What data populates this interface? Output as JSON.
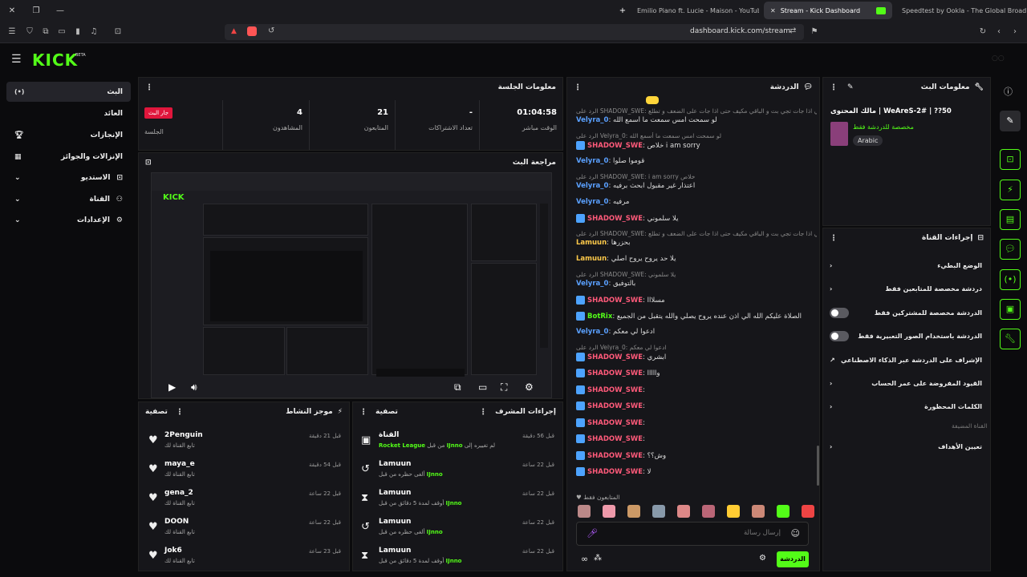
{
  "browser": {
    "tabs": [
      {
        "title": "Emilio Piano ft. Lucie - Maison - YouTube"
      },
      {
        "title": "Stream - Kick Dashboard"
      },
      {
        "title": "Speedtest by Ookla - The Global Broadband"
      }
    ],
    "url": "dashboard.kick.com/stream"
  },
  "brand": {
    "logo": "KICK",
    "beta": "BETA",
    "accent": "#53fc18"
  },
  "sidebar": {
    "items": [
      {
        "label": "البث",
        "icon": "broadcast-icon"
      },
      {
        "label": "العائد",
        "icon": ""
      },
      {
        "label": "الإنجازات",
        "icon": "trophy-icon"
      },
      {
        "label": "الإنزالات والجوائز",
        "icon": "gift-icon"
      },
      {
        "label": "الاستديو",
        "icon": "studio-icon"
      },
      {
        "label": "القناة",
        "icon": "users-icon"
      },
      {
        "label": "الإعدادات",
        "icon": "gear-icon"
      }
    ]
  },
  "session": {
    "title": "معلومات الجلسة",
    "live_badge": "جار البث",
    "session_label": "الجلسة",
    "stats": [
      {
        "value": "01:04:58",
        "label": "الوقت مباشر"
      },
      {
        "value": "-",
        "label": "تعداد الاشتراكات"
      },
      {
        "value": "21",
        "label": "المتابعون"
      },
      {
        "value": "4",
        "label": "المشاهدون"
      }
    ]
  },
  "preview": {
    "title": "مراجعة البث"
  },
  "activity": {
    "title": "موجز النشاط",
    "filter": "تصفية",
    "items": [
      {
        "name": "2Penguin",
        "sub": "تابع القناة لك",
        "time": "قبل 21 دقيقة"
      },
      {
        "name": "maya_e",
        "sub": "تابع القناة لك",
        "time": "قبل 54 دقيقة"
      },
      {
        "name": "gena_2",
        "sub": "تابع القناة لك",
        "time": "قبل 22 ساعة"
      },
      {
        "name": "DOON",
        "sub": "تابع القناة لك",
        "time": "قبل 22 ساعة"
      },
      {
        "name": "Jok6",
        "sub": "تابع القناة لك",
        "time": "قبل 23 ساعة"
      }
    ]
  },
  "modlog": {
    "title": "إجراءات المشرف",
    "filter": "تصفية",
    "items": [
      {
        "name": "القناة",
        "sub_pre": "Rocket League",
        "sub_mid": " من قبل ",
        "sub_user": "IJnno",
        "sub_post": " لم تغييره إلى",
        "time": "قبل 56 دقيقة",
        "icon": "channel-icon"
      },
      {
        "name": "Lamuun",
        "sub_pre": "",
        "sub_mid": "ألغى حظره من قبل ",
        "sub_user": "IJnno",
        "sub_post": "",
        "time": "قبل 22 ساعة",
        "icon": "undo-icon"
      },
      {
        "name": "Lamuun",
        "sub_pre": "",
        "sub_mid": "أوقف لمدة 5 دقائق من قبل ",
        "sub_user": "IJnno",
        "sub_post": "",
        "time": "قبل 22 ساعة",
        "icon": "hourglass-icon"
      },
      {
        "name": "Lamuun",
        "sub_pre": "",
        "sub_mid": "ألغى حظره من قبل ",
        "sub_user": "IJnno",
        "sub_post": "",
        "time": "قبل 22 ساعة",
        "icon": "undo-icon"
      },
      {
        "name": "Lamuun",
        "sub_pre": "",
        "sub_mid": "أوقف لمدة 5 دقائق من قبل ",
        "sub_user": "IJnno",
        "sub_post": "",
        "time": "قبل 22 ساعة",
        "icon": "hourglass-icon"
      }
    ]
  },
  "chat": {
    "title": "الدردشة",
    "followers_only": "المتابعون فقط",
    "input_placeholder": "إرسال رسالة",
    "send_label": "الدردشة",
    "lines": [
      {
        "reply": "الرد على SHADOW_SWE: دوزني اذا جات تجي بت و الباقي مكيف حتى اذا جات على الضعف و تطلع",
        "user": "Velyra_0",
        "cls": "user-b",
        "text": "لو سمحت امس سمعت ما أسمع الله"
      },
      {
        "reply": "الرد على Velyra_0: لو سمحت امس سمعت ما أسمع الله",
        "user": "SHADOW_SWE",
        "cls": "user-r",
        "text": "خلاص i am sorry"
      },
      {
        "reply": "",
        "user": "Velyra_0",
        "cls": "user-b",
        "text": "قوموا صلوا"
      },
      {
        "reply": "الرد على SHADOW_SWE: i am sorry خلاص",
        "user": "Velyra_0",
        "cls": "user-b",
        "text": "اعتذار غير مقبول ابحث برفيه"
      },
      {
        "reply": "",
        "user": "Velyra_0",
        "cls": "user-b",
        "text": "مرفيه"
      },
      {
        "reply": "",
        "user": "SHADOW_SWE",
        "cls": "user-r",
        "text": "يلا سلموني"
      },
      {
        "reply": "الرد على SHADOW_SWE: دوزني اذا جات تجي بت و الباقي مكيف حتى اذا جات على الضعف و تطلع",
        "user": "Lamuun",
        "cls": "user-y",
        "text": "بحزرها"
      },
      {
        "reply": "",
        "user": "Lamuun",
        "cls": "user-y",
        "text": "يلا حد يروح يروح اصلي"
      },
      {
        "reply": "الرد على SHADOW_SWE: يلا سلموني",
        "user": "Velyra_0",
        "cls": "user-b",
        "text": "بالتوفيق"
      },
      {
        "reply": "",
        "user": "SHADOW_SWE",
        "cls": "user-r",
        "text": "مسلااا"
      },
      {
        "reply": "",
        "user": "BotRix",
        "cls": "user-g",
        "text": "الصلاة عليكم الله الي اذن عنده يروح يصلي والله يتقبل من الجميع"
      },
      {
        "reply": "",
        "user": "Velyra_0",
        "cls": "user-b",
        "text": "ادعوا لي معكم"
      },
      {
        "reply": "الرد على Velyra_0: ادعوا لي معكم",
        "user": "SHADOW_SWE",
        "cls": "user-r",
        "text": "ابشري"
      },
      {
        "reply": "",
        "user": "SHADOW_SWE",
        "cls": "user-r",
        "text": "وااااا"
      },
      {
        "reply": "",
        "user": "SHADOW_SWE",
        "cls": "user-r",
        "text": ""
      },
      {
        "reply": "",
        "user": "SHADOW_SWE",
        "cls": "user-r",
        "text": ""
      },
      {
        "reply": "",
        "user": "SHADOW_SWE",
        "cls": "user-r",
        "text": ""
      },
      {
        "reply": "",
        "user": "SHADOW_SWE",
        "cls": "user-r",
        "text": ""
      },
      {
        "reply": "",
        "user": "SHADOW_SWE",
        "cls": "user-r",
        "text": "وش؟؟"
      },
      {
        "reply": "",
        "user": "SHADOW_SWE",
        "cls": "user-r",
        "text": "لا"
      }
    ]
  },
  "stream_info": {
    "title": "معلومات البث",
    "stream_title": "مالك المحتوى | WeAreS-2# | ??50",
    "sub_line": "مخصصة للدردشة فقط",
    "language": "Arabic"
  },
  "channel_actions": {
    "title": "إجراءات القناة",
    "items": [
      {
        "label": "الوضع البطيء",
        "kind": "chevron"
      },
      {
        "label": "دردشة مخصصة للمتابعين فقط",
        "kind": "chevron"
      },
      {
        "label": "الدردشة مخصصة للمشتركين فقط",
        "kind": "toggle"
      },
      {
        "label": "الدردشة باستخدام الصور التعبيرية فقط",
        "kind": "toggle"
      },
      {
        "label": "الإشراف على الدردشة عبر الذكاء الاصطناعي",
        "kind": "external"
      },
      {
        "label": "القيود المفروضة على عمر الحساب",
        "kind": "chevron"
      },
      {
        "label": "الكلمات المحظورة",
        "kind": "chevron"
      }
    ],
    "section_label": "القناة المضيفة",
    "host_label": "تعيين الأهداف"
  }
}
